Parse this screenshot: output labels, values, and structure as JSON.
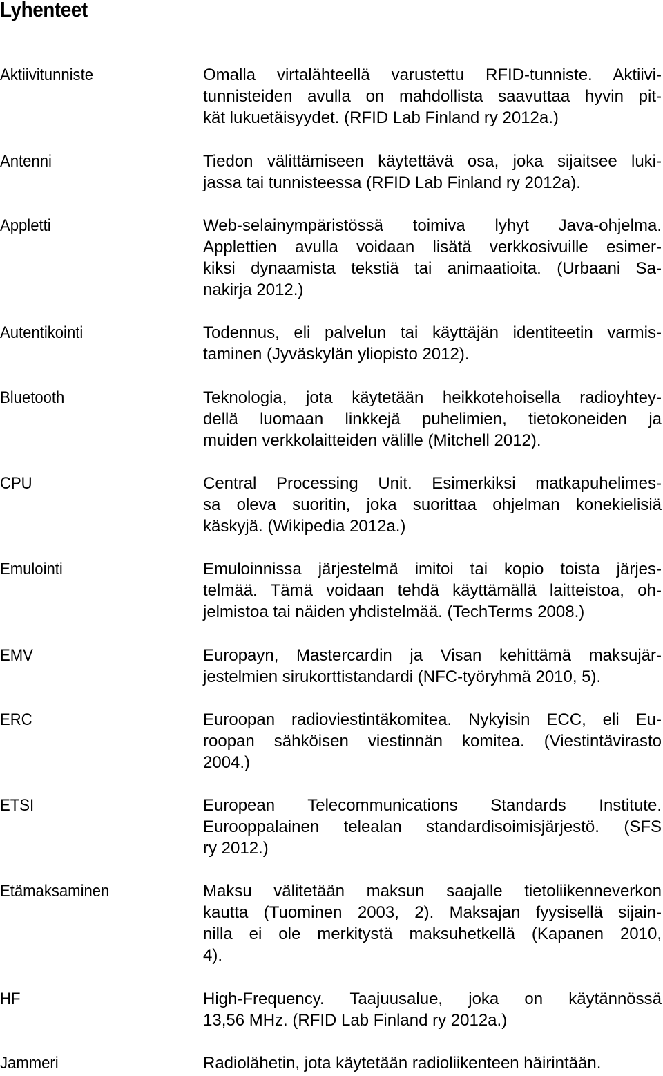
{
  "page": {
    "title": "Lyhenteet"
  },
  "entries": [
    {
      "term": "Aktiivitunniste",
      "lines": [
        "Omalla virtalähteellä varustettu RFID-tunniste. Aktiivi-",
        "tunnisteiden avulla on mahdollista saavuttaa hyvin pit-",
        "kät lukuetäisyydet. (RFID Lab Finland ry 2012a.)"
      ]
    },
    {
      "term": "Antenni",
      "lines": [
        "Tiedon välittämiseen käytettävä osa, joka sijaitsee luki-",
        "jassa tai tunnisteessa (RFID Lab Finland ry 2012a)."
      ]
    },
    {
      "term": "Appletti",
      "lines": [
        "Web-selainympäristössä toimiva lyhyt Java-ohjelma.",
        "Applettien avulla voidaan lisätä verkkosivuille esimer-",
        "kiksi dynaamista tekstiä tai animaatioita. (Urbaani Sa-",
        "nakirja 2012.)"
      ]
    },
    {
      "term": "Autentikointi",
      "lines": [
        "Todennus, eli palvelun tai käyttäjän identiteetin varmis-",
        "taminen (Jyväskylän yliopisto 2012)."
      ]
    },
    {
      "term": "Bluetooth",
      "lines": [
        "Teknologia, jota käytetään heikkotehoisella radioyhtey-",
        "dellä luomaan linkkejä puhelimien, tietokoneiden ja",
        "muiden verkkolaitteiden välille (Mitchell 2012)."
      ]
    },
    {
      "term": "CPU",
      "lines": [
        "Central Processing Unit. Esimerkiksi matkapuhelimes-",
        "sa oleva suoritin, joka suorittaa ohjelman konekielisiä",
        "käskyjä. (Wikipedia 2012a.)"
      ]
    },
    {
      "term": "Emulointi",
      "lines": [
        "Emuloinnissa järjestelmä imitoi tai kopio toista järjes-",
        "telmää. Tämä voidaan tehdä käyttämällä laitteistoa, oh-",
        "jelmistoa tai näiden yhdistelmää. (TechTerms 2008.)"
      ]
    },
    {
      "term": "EMV",
      "lines": [
        "Europayn, Mastercardin ja Visan kehittämä maksujär-",
        "jestelmien sirukorttistandardi (NFC-työryhmä 2010, 5)."
      ]
    },
    {
      "term": "ERC",
      "lines": [
        "Euroopan radioviestintäkomitea. Nykyisin ECC, eli Eu-",
        "roopan sähköisen viestinnän komitea. (Viestintävirasto",
        "2004.)"
      ]
    },
    {
      "term": "ETSI",
      "lines": [
        "European Telecommunications Standards Institute.",
        "Eurooppalainen telealan standardisoimisjärjestö. (SFS",
        "ry 2012.)"
      ]
    },
    {
      "term": "Etämaksaminen",
      "lines": [
        "Maksu välitetään maksun saajalle tietoliikenneverkon",
        "kautta (Tuominen 2003, 2). Maksajan fyysisellä sijain-",
        "nilla ei ole merkitystä maksuhetkellä (Kapanen 2010,",
        "4)."
      ]
    },
    {
      "term": "HF",
      "lines": [
        "High-Frequency. Taajuusalue, joka on käytännössä",
        "13,56 MHz. (RFID Lab Finland ry 2012a.)"
      ]
    },
    {
      "term": "Jammeri",
      "lines": [
        "Radiolähetin, jota käytetään radioliikenteen häirintään."
      ]
    }
  ]
}
